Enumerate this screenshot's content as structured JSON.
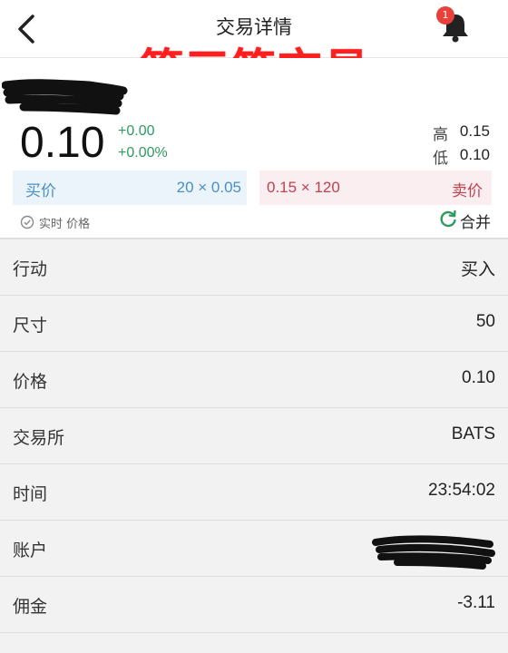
{
  "header": {
    "title": "交易详情",
    "back_icon": "chevron-left-icon",
    "bell_icon": "bell-icon",
    "notification_count": "1"
  },
  "overlay_caption": "第三笔交易",
  "quote": {
    "last_price": "0.10",
    "change": "+0.00",
    "change_percent": "+0.00%",
    "high_label": "高",
    "high_value": "0.15",
    "low_label": "低",
    "low_value": "0.10",
    "bid_label": "买价",
    "bid_size_price": "20 × 0.05",
    "ask_size_price": "0.15 × 120",
    "ask_label": "卖价",
    "realtime_label": "实时 价格",
    "merge_label": "合并"
  },
  "details": [
    {
      "label": "行动",
      "value": "买入"
    },
    {
      "label": "尺寸",
      "value": "50"
    },
    {
      "label": "价格",
      "value": "0.10"
    },
    {
      "label": "交易所",
      "value": "BATS"
    },
    {
      "label": "时间",
      "value": "23:54:02"
    },
    {
      "label": "账户",
      "value": ""
    },
    {
      "label": "佣金",
      "value": "-3.11"
    }
  ],
  "colors": {
    "positive": "#2e9a62",
    "bid": "#4a8fc3",
    "ask": "#c0414f",
    "badge": "#e8403a",
    "overlay": "#ff1f1f"
  }
}
